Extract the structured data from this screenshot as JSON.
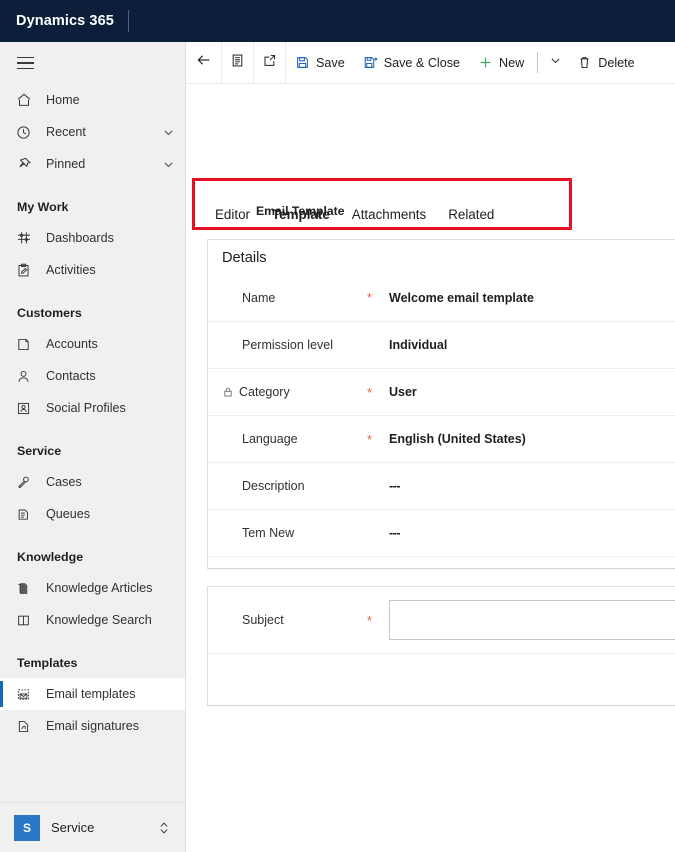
{
  "topbar": {
    "brand": "Dynamics 365"
  },
  "sidebar": {
    "menu_button": "site-map-toggle",
    "primary": [
      {
        "label": "Home",
        "icon": "home-icon",
        "expandable": false
      },
      {
        "label": "Recent",
        "icon": "clock-icon",
        "expandable": true
      },
      {
        "label": "Pinned",
        "icon": "pin-icon",
        "expandable": true
      }
    ],
    "groups": [
      {
        "title": "My Work",
        "items": [
          {
            "label": "Dashboards",
            "icon": "dashboard-icon"
          },
          {
            "label": "Activities",
            "icon": "activities-icon"
          }
        ]
      },
      {
        "title": "Customers",
        "items": [
          {
            "label": "Accounts",
            "icon": "account-icon"
          },
          {
            "label": "Contacts",
            "icon": "contact-icon"
          },
          {
            "label": "Social Profiles",
            "icon": "social-profile-icon"
          }
        ]
      },
      {
        "title": "Service",
        "items": [
          {
            "label": "Cases",
            "icon": "case-icon"
          },
          {
            "label": "Queues",
            "icon": "queue-icon"
          }
        ]
      },
      {
        "title": "Knowledge",
        "items": [
          {
            "label": "Knowledge Articles",
            "icon": "knowledge-article-icon"
          },
          {
            "label": "Knowledge Search",
            "icon": "knowledge-search-icon"
          }
        ]
      },
      {
        "title": "Templates",
        "items": [
          {
            "label": "Email templates",
            "icon": "email-template-icon",
            "selected": true
          },
          {
            "label": "Email signatures",
            "icon": "email-signature-icon",
            "selected": false
          }
        ]
      }
    ],
    "app_switcher": {
      "tile_letter": "S",
      "app_name": "Service"
    }
  },
  "commandbar": {
    "back": "back-arrow",
    "form_selector": "form-icon",
    "popout": "open-in-new-window-icon",
    "save_label": "Save",
    "save_close_label": "Save & Close",
    "new_label": "New",
    "overflow_caret": "chevron-down-icon",
    "delete_label": "Delete"
  },
  "form": {
    "entity_label": "Email Template",
    "tabs": [
      {
        "label": "Editor",
        "active": false
      },
      {
        "label": "Template",
        "active": true
      },
      {
        "label": "Attachments",
        "active": false
      },
      {
        "label": "Related",
        "active": false
      }
    ],
    "details_section": {
      "title": "Details",
      "fields": [
        {
          "label": "Name",
          "required": true,
          "value": "Welcome email template",
          "locked": false
        },
        {
          "label": "Permission level",
          "required": false,
          "value": "Individual",
          "locked": false
        },
        {
          "label": "Category",
          "required": true,
          "value": "User",
          "locked": true
        },
        {
          "label": "Language",
          "required": true,
          "value": "English (United States)",
          "locked": false
        },
        {
          "label": "Description",
          "required": false,
          "value": "---",
          "locked": false
        },
        {
          "label": "Tem New",
          "required": false,
          "value": "---",
          "locked": false
        }
      ]
    },
    "subject_section": {
      "label": "Subject",
      "required": true,
      "value": "",
      "placeholder": ""
    }
  },
  "annotation": {
    "highlight_target": "form-tab-strip",
    "color": "#e81123"
  },
  "colors": {
    "header_bg": "#0b1f3a",
    "accent_blue": "#2266cc",
    "selection_blue": "#0f6cbd",
    "required_red": "#e8604c",
    "annotation_red": "#e81123",
    "sidebar_bg": "#f0f0f0"
  }
}
